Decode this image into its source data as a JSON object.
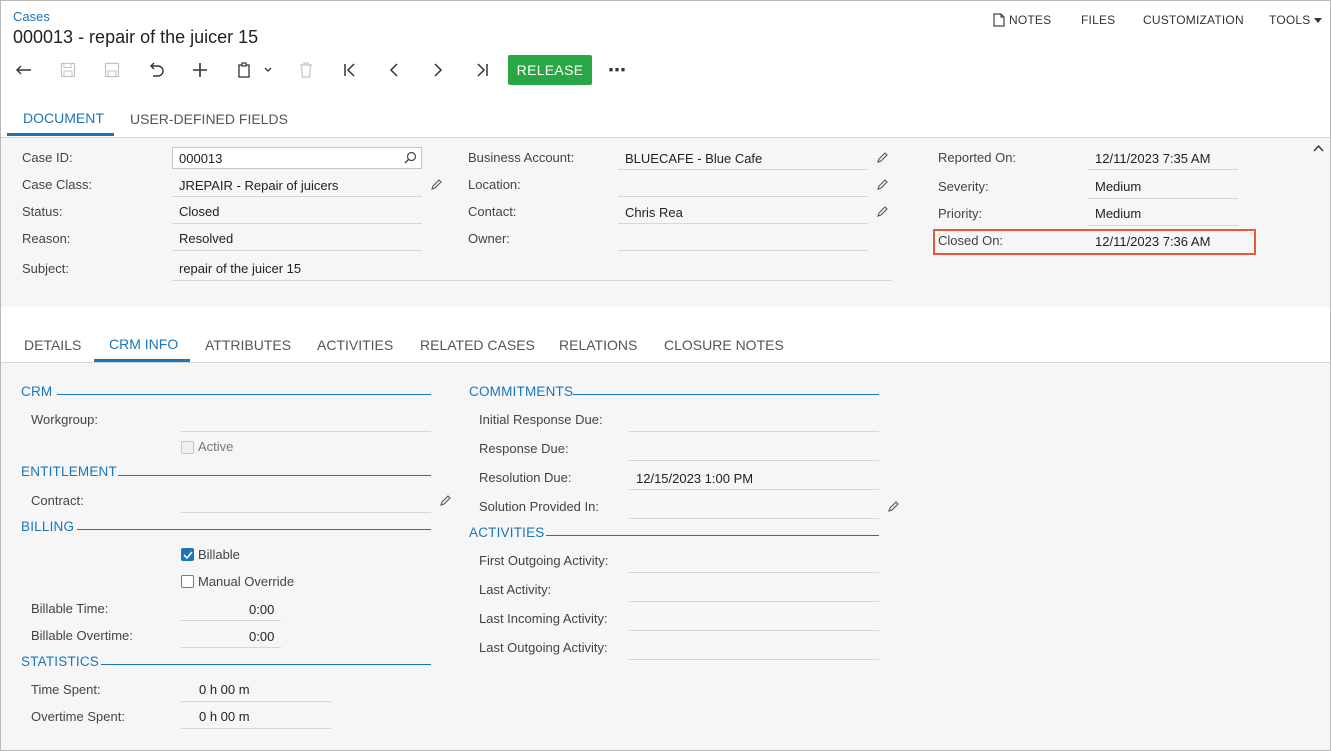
{
  "breadcrumb": "Cases",
  "title": "000013 - repair of the juicer 15",
  "top_menu": {
    "notes": "NOTES",
    "files": "FILES",
    "customization": "CUSTOMIZATION",
    "tools": "TOOLS"
  },
  "toolbar": {
    "release": "RELEASE",
    "more": "⋯"
  },
  "main_tabs": {
    "document": "DOCUMENT",
    "user_defined": "USER-DEFINED FIELDS"
  },
  "header": {
    "case_id_label": "Case ID:",
    "case_id": "000013",
    "case_class_label": "Case Class:",
    "case_class": "JREPAIR - Repair of juicers",
    "status_label": "Status:",
    "status": "Closed",
    "reason_label": "Reason:",
    "reason": "Resolved",
    "subject_label": "Subject:",
    "subject": "repair of the juicer 15",
    "business_account_label": "Business Account:",
    "business_account": "BLUECAFE - Blue Cafe",
    "location_label": "Location:",
    "location": "",
    "contact_label": "Contact:",
    "contact": "Chris Rea",
    "owner_label": "Owner:",
    "owner": "",
    "reported_on_label": "Reported On:",
    "reported_on": "12/11/2023 7:35 AM",
    "severity_label": "Severity:",
    "severity": "Medium",
    "priority_label": "Priority:",
    "priority": "Medium",
    "closed_on_label": "Closed On:",
    "closed_on": "12/11/2023 7:36 AM"
  },
  "sub_tabs": {
    "details": "DETAILS",
    "crm_info": "CRM INFO",
    "attributes": "ATTRIBUTES",
    "activities": "ACTIVITIES",
    "related_cases": "RELATED CASES",
    "relations": "RELATIONS",
    "closure_notes": "CLOSURE NOTES"
  },
  "crm": {
    "title": "CRM",
    "workgroup_label": "Workgroup:",
    "workgroup": "",
    "active_label": "Active",
    "active": false
  },
  "entitlement": {
    "title": "ENTITLEMENT",
    "contract_label": "Contract:",
    "contract": ""
  },
  "billing": {
    "title": "BILLING",
    "billable_label": "Billable",
    "billable": true,
    "manual_override_label": "Manual Override",
    "manual_override": false,
    "billable_time_label": "Billable Time:",
    "billable_time": "0:00",
    "billable_overtime_label": "Billable Overtime:",
    "billable_overtime": "0:00"
  },
  "statistics": {
    "title": "STATISTICS",
    "time_spent_label": "Time Spent:",
    "time_spent": "0 h 00 m",
    "overtime_spent_label": "Overtime Spent:",
    "overtime_spent": "0 h 00 m"
  },
  "commitments": {
    "title": "COMMITMENTS",
    "initial_response_label": "Initial Response Due:",
    "initial_response": "",
    "response_due_label": "Response Due:",
    "response_due": "",
    "resolution_due_label": "Resolution Due:",
    "resolution_due": "12/15/2023 1:00 PM",
    "solution_provided_label": "Solution Provided In:",
    "solution_provided": ""
  },
  "activities": {
    "title": "ACTIVITIES",
    "first_outgoing_label": "First Outgoing Activity:",
    "first_outgoing": "",
    "last_activity_label": "Last Activity:",
    "last_activity": "",
    "last_incoming_label": "Last Incoming Activity:",
    "last_incoming": "",
    "last_outgoing_label": "Last Outgoing Activity:",
    "last_outgoing": ""
  },
  "colors": {
    "accent": "#1a75bb",
    "release": "#29a745",
    "highlight": "#e8583a"
  }
}
